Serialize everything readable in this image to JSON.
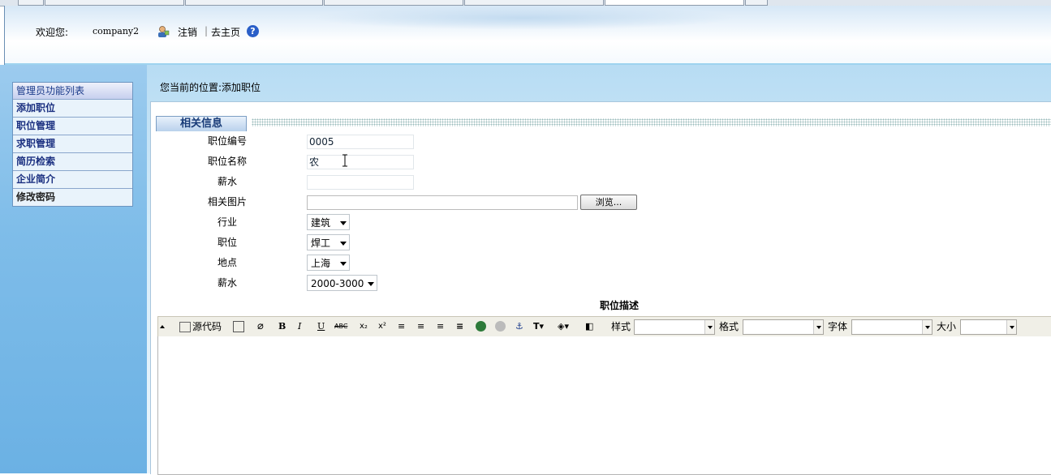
{
  "header": {
    "welcome_label": "欢迎您:",
    "username": "company2",
    "logout_label": "注销",
    "separator": "|",
    "home_label": "去主页",
    "help_icon": "help-icon",
    "user_icon": "user-icon"
  },
  "sidebar": {
    "title": "管理员功能列表",
    "items": [
      {
        "label": "添加职位"
      },
      {
        "label": "职位管理"
      },
      {
        "label": "求职管理"
      },
      {
        "label": "简历检索"
      },
      {
        "label": "企业简介"
      },
      {
        "label": "修改密码"
      }
    ]
  },
  "main": {
    "breadcrumb": "您当前的位置:添加职位",
    "section_tab": "相关信息"
  },
  "form": {
    "job_no_label": "职位编号",
    "job_no_value": "0005",
    "job_name_label": "职位名称",
    "job_name_value": "农",
    "salary_text_label": "薪水",
    "salary_text_value": "",
    "image_label": "相关图片",
    "browse_label": "浏览...",
    "industry_label": "行业",
    "industry_value": "建筑",
    "position_label": "职位",
    "position_value": "焊工",
    "location_label": "地点",
    "location_value": "上海",
    "salary_label": "薪水",
    "salary_value": "2000-3000",
    "desc_title": "职位描述"
  },
  "editor": {
    "source_label": "源代码",
    "style_label": "样式",
    "format_label": "格式",
    "font_label": "字体",
    "size_label": "大小",
    "bold": "B",
    "italic": "I",
    "underline": "U",
    "strike": "ABC",
    "subscript": "x₂",
    "superscript": "x²"
  }
}
